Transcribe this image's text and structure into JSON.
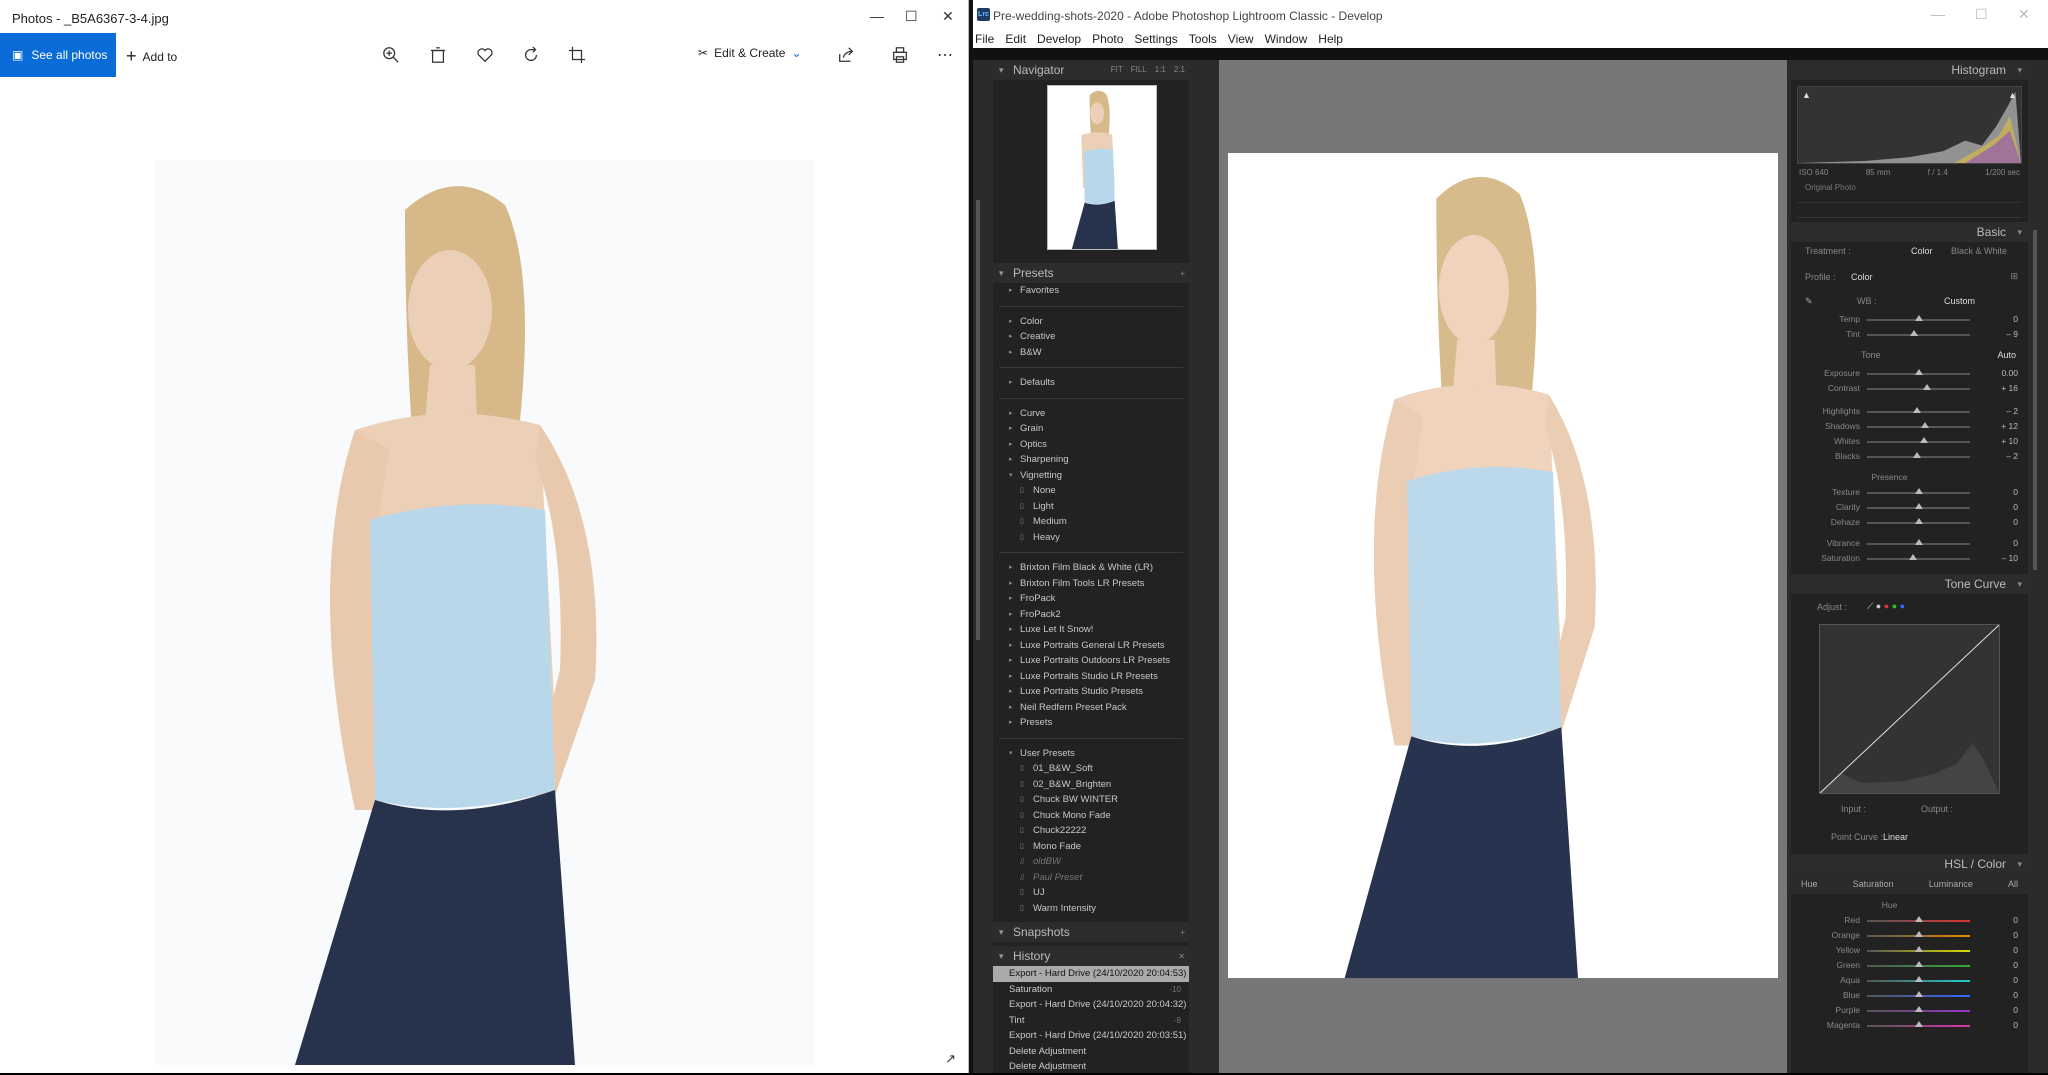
{
  "photos": {
    "title": "Photos - _B5A6367-3-4.jpg",
    "see_all": "See all photos",
    "add_to": "Add to",
    "edit_create": "Edit & Create",
    "window_controls": [
      "—",
      "☐",
      "✕"
    ]
  },
  "lightroom": {
    "logo": "Lrc",
    "title": "Pre-wedding-shots-2020 - Adobe Photoshop Lightroom Classic - Develop",
    "menu": [
      "File",
      "Edit",
      "Develop",
      "Photo",
      "Settings",
      "Tools",
      "View",
      "Window",
      "Help"
    ],
    "navigator": {
      "label": "Navigator",
      "opts": [
        "FIT",
        "FILL",
        "1:1",
        "2:1"
      ]
    },
    "presets_label": "Presets",
    "preset_groups": [
      [
        "Favorites"
      ],
      [
        "Color",
        "Creative",
        "B&W"
      ],
      [
        "Defaults"
      ],
      [
        "Curve",
        "Grain",
        "Optics",
        "Sharpening"
      ]
    ],
    "vignetting": {
      "label": "Vignetting",
      "items": [
        "None",
        "Light",
        "Medium",
        "Heavy"
      ]
    },
    "third_party": [
      "Brixton Film Black & White (LR)",
      "Brixton Film Tools LR Presets",
      "FroPack",
      "FroPack2",
      "Luxe Let It Snow!",
      "Luxe Portraits General LR Presets",
      "Luxe Portraits Outdoors LR Presets",
      "Luxe Portraits Studio LR Presets",
      "Luxe Portraits Studio Presets",
      "Neil Redfern Preset Pack",
      "Presets"
    ],
    "user_presets": {
      "label": "User Presets",
      "items": [
        "01_B&W_Soft",
        "02_B&W_Brighten",
        "Chuck BW WINTER",
        "Chuck Mono Fade",
        "Chuck22222",
        "Mono Fade",
        "oldBW",
        "Paul Preset",
        "UJ",
        "Warm Intensity"
      ]
    },
    "snapshots_label": "Snapshots",
    "history_label": "History",
    "history": [
      {
        "label": "Export - Hard Drive (24/10/2020 20:04:53)",
        "v": ""
      },
      {
        "label": "Saturation",
        "v": "-10"
      },
      {
        "label": "Export - Hard Drive (24/10/2020 20:04:32)",
        "v": ""
      },
      {
        "label": "Tint",
        "v": "-9"
      },
      {
        "label": "Export - Hard Drive (24/10/2020 20:03:51)",
        "v": ""
      },
      {
        "label": "Delete Adjustment",
        "v": ""
      },
      {
        "label": "Delete Adjustment",
        "v": ""
      }
    ],
    "histogram": {
      "label": "Histogram",
      "iso": "ISO 640",
      "focal": "85 mm",
      "aperture": "f / 1.4",
      "shutter": "1/200 sec",
      "original": "Original Photo"
    },
    "basic": {
      "label": "Basic",
      "treatment": "Treatment :",
      "color": "Color",
      "bw": "Black & White",
      "profile": "Profile :",
      "profile_val": "Color",
      "wb": "WB :",
      "wb_val": "Custom",
      "tone": "Tone",
      "auto": "Auto",
      "presence": "Presence",
      "sliders_wb": [
        {
          "l": "Temp",
          "v": "0",
          "p": 0.5
        },
        {
          "l": "Tint",
          "v": "– 9",
          "p": 0.46
        }
      ],
      "sliders_tone": [
        {
          "l": "Exposure",
          "v": "0.00",
          "p": 0.5
        },
        {
          "l": "Contrast",
          "v": "+ 16",
          "p": 0.58
        }
      ],
      "sliders_tone2": [
        {
          "l": "Highlights",
          "v": "– 2",
          "p": 0.49
        },
        {
          "l": "Shadows",
          "v": "+ 12",
          "p": 0.56
        },
        {
          "l": "Whites",
          "v": "+ 10",
          "p": 0.55
        },
        {
          "l": "Blacks",
          "v": "– 2",
          "p": 0.49
        }
      ],
      "sliders_presence": [
        {
          "l": "Texture",
          "v": "0",
          "p": 0.5
        },
        {
          "l": "Clarity",
          "v": "0",
          "p": 0.5
        },
        {
          "l": "Dehaze",
          "v": "0",
          "p": 0.5
        }
      ],
      "sliders_vib": [
        {
          "l": "Vibrance",
          "v": "0",
          "p": 0.5
        },
        {
          "l": "Saturation",
          "v": "– 10",
          "p": 0.45
        }
      ]
    },
    "tone_curve": {
      "label": "Tone Curve",
      "adjust": "Adjust :",
      "input": "Input :",
      "output": "Output :",
      "point_curve": "Point Curve :",
      "point_val": "Linear"
    },
    "hsl": {
      "label": "HSL / Color",
      "tabs": [
        "Hue",
        "Saturation",
        "Luminance",
        "All"
      ],
      "sub": "Hue",
      "sliders": [
        {
          "l": "Red",
          "v": "0"
        },
        {
          "l": "Orange",
          "v": "0"
        },
        {
          "l": "Yellow",
          "v": "0"
        },
        {
          "l": "Green",
          "v": "0"
        },
        {
          "l": "Aqua",
          "v": "0"
        },
        {
          "l": "Blue",
          "v": "0"
        },
        {
          "l": "Purple",
          "v": "0"
        },
        {
          "l": "Magenta",
          "v": "0"
        }
      ]
    }
  }
}
